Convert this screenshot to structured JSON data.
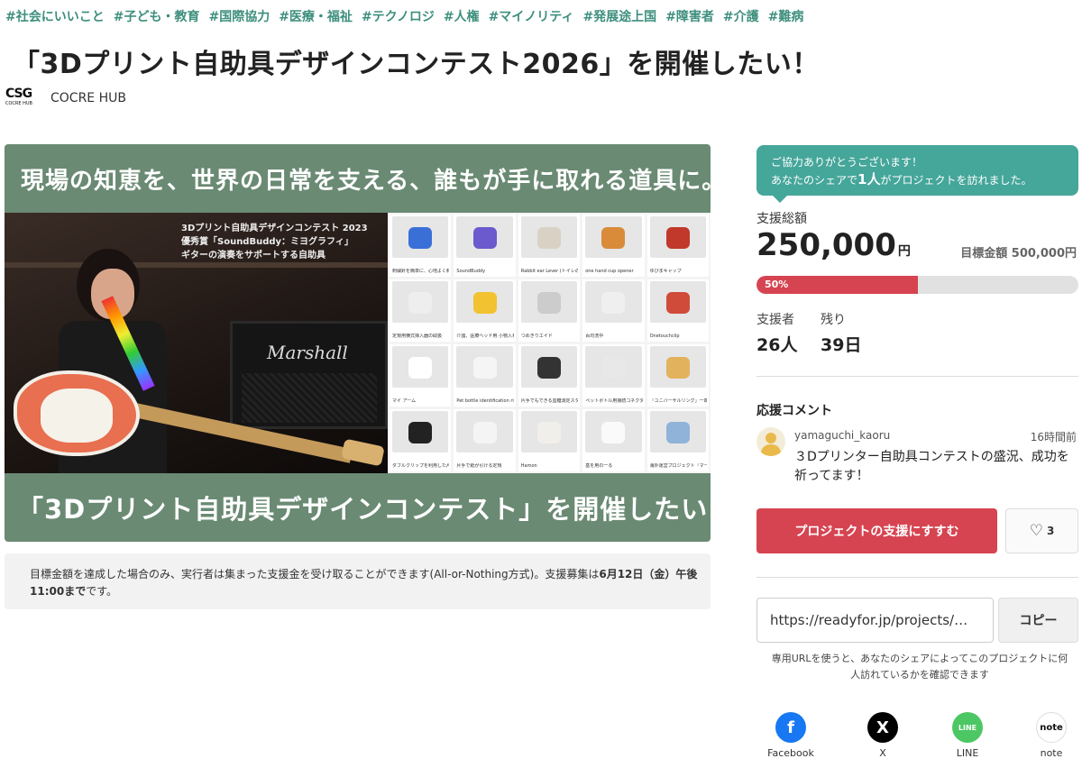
{
  "tags": [
    "#社会にいいこと",
    "#子ども・教育",
    "#国際協力",
    "#医療・福祉",
    "#テクノロジ",
    "#人権",
    "#マイノリティ",
    "#発展途上国",
    "#障害者",
    "#介護",
    "#難病"
  ],
  "project": {
    "title": "「3Dプリント自助具デザインコンテスト2026」を開催したい！",
    "owner_name": "COCRE HUB",
    "owner_logo_mark": "CSG",
    "owner_logo_sub": "COCRE HUB"
  },
  "hero": {
    "top_text": "現場の知恵を、世界の日常を支える、誰もが手に取れる道具に。",
    "bottom_text": "「3Dプリント自助具デザインコンテスト」を開催したい！",
    "photo_caption": [
      "3Dプリント自助具デザインコンテスト 2023",
      "優秀賞「SoundBuddy：ミヨグラフィ」",
      "ギターの演奏をサポートする自助具"
    ],
    "amp_label": "Marshall",
    "grid_items": [
      {
        "caption": "刺繍針を簡単に、心地よく刺繍",
        "color": "#3b6fd8"
      },
      {
        "caption": "SoundBuddy",
        "color": "#6a5acd"
      },
      {
        "caption": "Rabbit ear Lever (トイレの紐)",
        "color": "#d9d2c4"
      },
      {
        "caption": "one hand cup opener",
        "color": "#d98b3a"
      },
      {
        "caption": "ゆびまキャップ",
        "color": "#c0392b"
      },
      {
        "caption": "定規用横式挿入器の取扱",
        "color": "#eeeeee"
      },
      {
        "caption": "介護、医療ヘッド用 小物入れ",
        "color": "#f2c230"
      },
      {
        "caption": "つめきりエイド",
        "color": "#cccccc"
      },
      {
        "caption": "百均洗中",
        "color": "#efefef"
      },
      {
        "caption": "Onetouchclip",
        "color": "#d14b3a"
      },
      {
        "caption": "マイ アーム",
        "color": "#ffffff"
      },
      {
        "caption": "Pet bottle identification ring",
        "color": "#f5f5f5"
      },
      {
        "caption": "片手でもできる血糖測定スタンド",
        "color": "#333333"
      },
      {
        "caption": "ペットボトル用接続コネクタ",
        "color": "#e8e8e8"
      },
      {
        "caption": "「ユニバーサルリング」一端",
        "color": "#e2b25c"
      },
      {
        "caption": "ダブルクリップを利用した片手で",
        "color": "#222222"
      },
      {
        "caption": "片手で紙が引ける定規",
        "color": "#f4f4f4"
      },
      {
        "caption": "Hamon",
        "color": "#f1efe9"
      },
      {
        "caption": "基を用の一る",
        "color": "#fafafa"
      },
      {
        "caption": "海外運営プロジェクト「マーレ」",
        "color": "#8fb3d9"
      }
    ]
  },
  "notice": {
    "text": "目標金額を達成した場合のみ、実行者は集まった支援金を受け取ることができます(All-or-Nothing方式)。支援募集は",
    "deadline": "6月12日（金）午後11:00まで",
    "suffix": "です。"
  },
  "toast": {
    "line1": "ご協力ありがとうございます！",
    "line2_prefix": "あなたのシェアで",
    "line2_count": "1人",
    "line2_suffix": "がプロジェクトを訪れました。"
  },
  "funding": {
    "total_label": "支援総額",
    "amount": "250,000",
    "currency": "円",
    "goal_text": "目標金額 500,000円",
    "progress_percent": 50,
    "progress_label": "50%",
    "supporters_label": "支援者",
    "supporters_value": "26人",
    "remaining_label": "残り",
    "remaining_value": "39日"
  },
  "comments": {
    "heading": "応援コメント",
    "items": [
      {
        "user": "yamaguchi_kaoru",
        "time": "16時間前",
        "text": "３Dプリンター自助具コンテストの盛況、成功を祈ってます！"
      }
    ]
  },
  "actions": {
    "support_label": "プロジェクトの支援にすすむ",
    "like_count": "3",
    "share_url": "https://readyfor.jp/projects/…",
    "copy_label": "コピー",
    "url_note": "専用URLを使うと、あなたのシェアによってこのプロジェクトに何人訪れているかを確認できます"
  },
  "share": [
    {
      "label": "Facebook",
      "icon": "facebook-icon",
      "glyph": "f",
      "color": "#1877f2"
    },
    {
      "label": "X",
      "icon": "x-icon",
      "glyph": "X",
      "color": "#000000"
    },
    {
      "label": "LINE",
      "icon": "line-icon",
      "glyph": "LINE",
      "color": "#4cc764"
    },
    {
      "label": "note",
      "icon": "note-icon",
      "glyph": "note",
      "color": "#ffffff"
    }
  ],
  "colors": {
    "accent": "#d64451",
    "tag": "#3e8f7e",
    "toast": "#45a69a",
    "hero": "#6a8a73"
  }
}
